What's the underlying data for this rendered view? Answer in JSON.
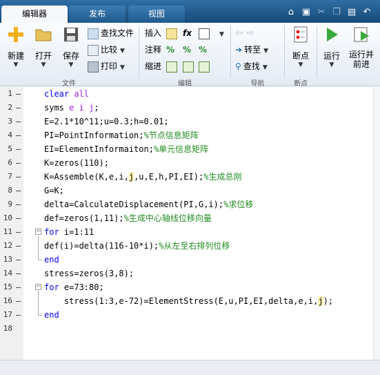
{
  "tabs": [
    {
      "label": "编辑器",
      "active": true
    },
    {
      "label": "发布",
      "active": false
    },
    {
      "label": "视图",
      "active": false
    }
  ],
  "toolstrip": {
    "file": {
      "group_label": "文件",
      "new_label": "新建",
      "open_label": "打开",
      "save_label": "保存",
      "find_files_label": "查找文件",
      "compare_label": "比较",
      "print_label": "打印"
    },
    "edit": {
      "group_label": "编辑",
      "insert_label": "插入",
      "comment_label": "注释",
      "indent_label": "缩进",
      "fx_label": "fx"
    },
    "navigate": {
      "group_label": "导航",
      "goto_label": "转至",
      "find_label": "查找"
    },
    "breakpoints": {
      "group_label": "断点",
      "breakpoints_label": "断点"
    },
    "run": {
      "run_label": "运行",
      "run_advance_label_1": "运行并",
      "run_advance_label_2": "前进"
    }
  },
  "code_lines": [
    {
      "n": "1",
      "dash": "–",
      "html": "<span class=\"kw\">clear</span> <span class=\"var\">all</span>"
    },
    {
      "n": "2",
      "dash": "–",
      "html": "syms <span class=\"var\">e i j</span>;"
    },
    {
      "n": "3",
      "dash": "–",
      "html": "E=2.1*10^11;u=0.3;h=0.01;"
    },
    {
      "n": "4",
      "dash": "–",
      "html": "PI=PointInformation;<span class=\"cm\">%节点信息矩阵</span>"
    },
    {
      "n": "5",
      "dash": "–",
      "html": "EI=ElementInformaiton;<span class=\"cm\">%单元信息矩阵</span>"
    },
    {
      "n": "6",
      "dash": "–",
      "html": "K=zeros(110);"
    },
    {
      "n": "7",
      "dash": "–",
      "html": "K=Assemble(K,e,i,<span class=\"hl\">j</span>,u,E,h,PI,EI);<span class=\"cm\">%生成总刚</span>"
    },
    {
      "n": "8",
      "dash": "–",
      "html": "G=K;"
    },
    {
      "n": "9",
      "dash": "–",
      "html": "delta=CalculateDisplacement(PI,G,i);<span class=\"cm\">%求位移</span>"
    },
    {
      "n": "10",
      "dash": "–",
      "html": "def=zeros(1,11);<span class=\"cm\">%生成中心轴线位移向量</span>"
    },
    {
      "n": "11",
      "dash": "–",
      "html": "<span class=\"kw\">for</span> i=1:11"
    },
    {
      "n": "12",
      "dash": "–",
      "html": "def(i)=delta(116-10*i);<span class=\"cm\">%从左至右排列位移</span>"
    },
    {
      "n": "13",
      "dash": "–",
      "html": "<span class=\"kw\">end</span>"
    },
    {
      "n": "14",
      "dash": "–",
      "html": "stress=zeros(3,8);"
    },
    {
      "n": "15",
      "dash": "–",
      "html": "<span class=\"kw\">for</span> e=73:80;"
    },
    {
      "n": "16",
      "dash": "–",
      "html": "    stress(1:3,e-72)=ElementStress(E,u,PI,EI,delta,e,i,<span class=\"hl\">j</span>);"
    },
    {
      "n": "17",
      "dash": "–",
      "html": "<span class=\"kw\">end</span>"
    },
    {
      "n": "18",
      "dash": "",
      "html": ""
    }
  ],
  "colors": {
    "keyword": "#0000ff",
    "string_var": "#a020f0",
    "comment": "#228b22",
    "tab_strip": "#1f5a8c"
  }
}
